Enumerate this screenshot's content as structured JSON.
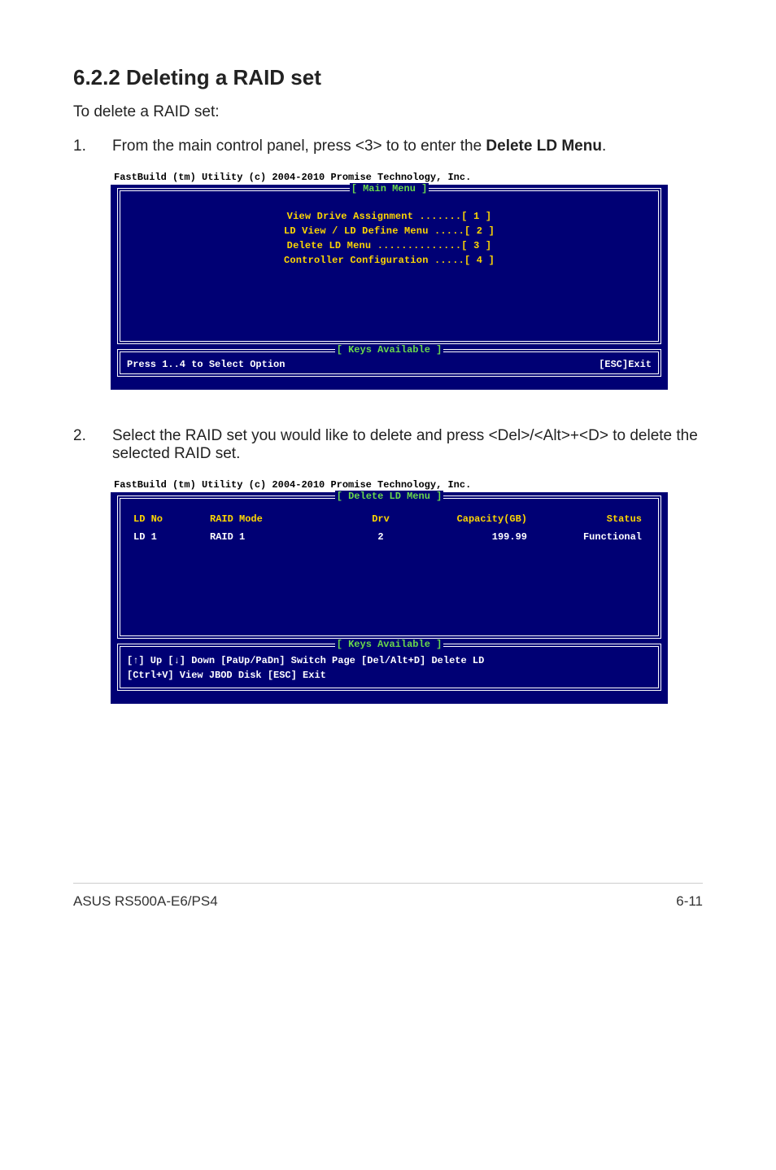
{
  "heading": "6.2.2      Deleting a RAID set",
  "intro": "To delete a RAID set:",
  "step1": {
    "num": "1.",
    "text_a": "From the main control panel, press <3> to to enter the ",
    "text_b": "Delete LD Menu",
    "text_c": "."
  },
  "step2": {
    "num": "2.",
    "text": "Select the RAID set you would like to delete and press <Del>/<Alt>+<D> to delete the selected RAID set."
  },
  "term_header": "FastBuild (tm) Utility (c) 2004-2010 Promise Technology, Inc.",
  "screen1": {
    "title": "[ Main Menu ]",
    "lines": [
      "View Drive Assignment .......[ 1 ]",
      "LD View / LD Define Menu .....[ 2 ]",
      "Delete LD Menu ..............[ 3 ]",
      "Controller Configuration .....[ 4 ]"
    ],
    "keys_title": "[ Keys Available ]",
    "footer_left": "Press 1..4 to Select Option",
    "footer_right": "[ESC]Exit"
  },
  "screen2": {
    "title": "[ Delete LD Menu ]",
    "columns": {
      "c1": "LD No",
      "c2": "RAID Mode",
      "c3": "Drv",
      "c4": "Capacity(GB)",
      "c5": "Status"
    },
    "row": {
      "c1": "LD  1",
      "c2": "RAID 1",
      "c3": "2",
      "c4": "199.99",
      "c5": "Functional"
    },
    "keys_title": "[ Keys Available ]",
    "keys_line1": "[↑] Up [↓] Down [PaUp/PaDn] Switch Page [Del/Alt+D] Delete LD",
    "keys_line2": "[Ctrl+V] View JBOD Disk  [ESC] Exit"
  },
  "footer": {
    "left": "ASUS RS500A-E6/PS4",
    "right": "6-11"
  }
}
